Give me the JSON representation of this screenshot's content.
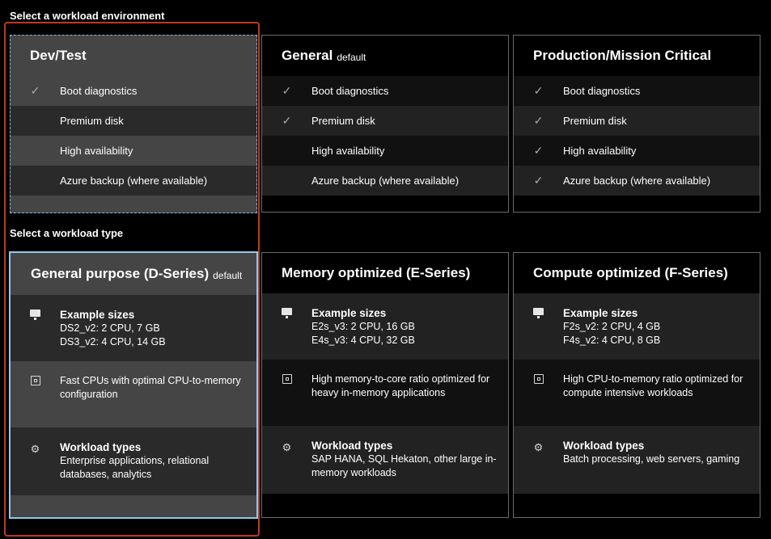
{
  "environment": {
    "heading": "Select a workload environment",
    "cards": [
      {
        "title": "Dev/Test",
        "subtitle": "",
        "selected": true,
        "features": [
          {
            "label": "Boot diagnostics",
            "checked": true
          },
          {
            "label": "Premium disk",
            "checked": false
          },
          {
            "label": "High availability",
            "checked": false
          },
          {
            "label": "Azure backup (where available)",
            "checked": false
          }
        ]
      },
      {
        "title": "General",
        "subtitle": "default",
        "selected": false,
        "features": [
          {
            "label": "Boot diagnostics",
            "checked": true
          },
          {
            "label": "Premium disk",
            "checked": true
          },
          {
            "label": "High availability",
            "checked": false
          },
          {
            "label": "Azure backup (where available)",
            "checked": false
          }
        ]
      },
      {
        "title": "Production/Mission Critical",
        "subtitle": "",
        "selected": false,
        "features": [
          {
            "label": "Boot diagnostics",
            "checked": true
          },
          {
            "label": "Premium disk",
            "checked": true
          },
          {
            "label": "High availability",
            "checked": true
          },
          {
            "label": "Azure backup (where available)",
            "checked": true
          }
        ]
      }
    ]
  },
  "workload_type": {
    "heading": "Select a workload type",
    "cards": [
      {
        "title": "General purpose (D-Series)",
        "subtitle": "default",
        "selected": true,
        "sizes_heading": "Example sizes",
        "sizes": [
          "DS2_v2: 2 CPU, 7 GB",
          "DS3_v2: 4 CPU, 14 GB"
        ],
        "cpu_text": "Fast CPUs with optimal CPU-to-memory configuration",
        "types_heading": "Workload types",
        "types_text": "Enterprise applications, relational databases, analytics"
      },
      {
        "title": "Memory optimized (E-Series)",
        "subtitle": "",
        "selected": false,
        "sizes_heading": "Example sizes",
        "sizes": [
          "E2s_v3: 2 CPU, 16 GB",
          "E4s_v3: 4 CPU, 32 GB"
        ],
        "cpu_text": "High memory-to-core ratio optimized for heavy in-memory applications",
        "types_heading": "Workload types",
        "types_text": "SAP HANA, SQL Hekaton, other large in-memory workloads"
      },
      {
        "title": "Compute optimized (F-Series)",
        "subtitle": "",
        "selected": false,
        "sizes_heading": "Example sizes",
        "sizes": [
          "F2s_v2: 2 CPU, 4 GB",
          "F4s_v2: 4 CPU, 8 GB"
        ],
        "cpu_text": "High CPU-to-memory ratio optimized for compute intensive workloads",
        "types_heading": "Workload types",
        "types_text": "Batch processing, web servers, gaming"
      }
    ]
  },
  "icons": {
    "check": "checkmark-icon",
    "sizes": "monitor-icon",
    "cpu": "cpu-chip-icon",
    "types": "gear-icon"
  },
  "colors": {
    "highlight": "#c0391f",
    "selected_border": "#8ec9ee",
    "selected_bg": "#454545"
  }
}
